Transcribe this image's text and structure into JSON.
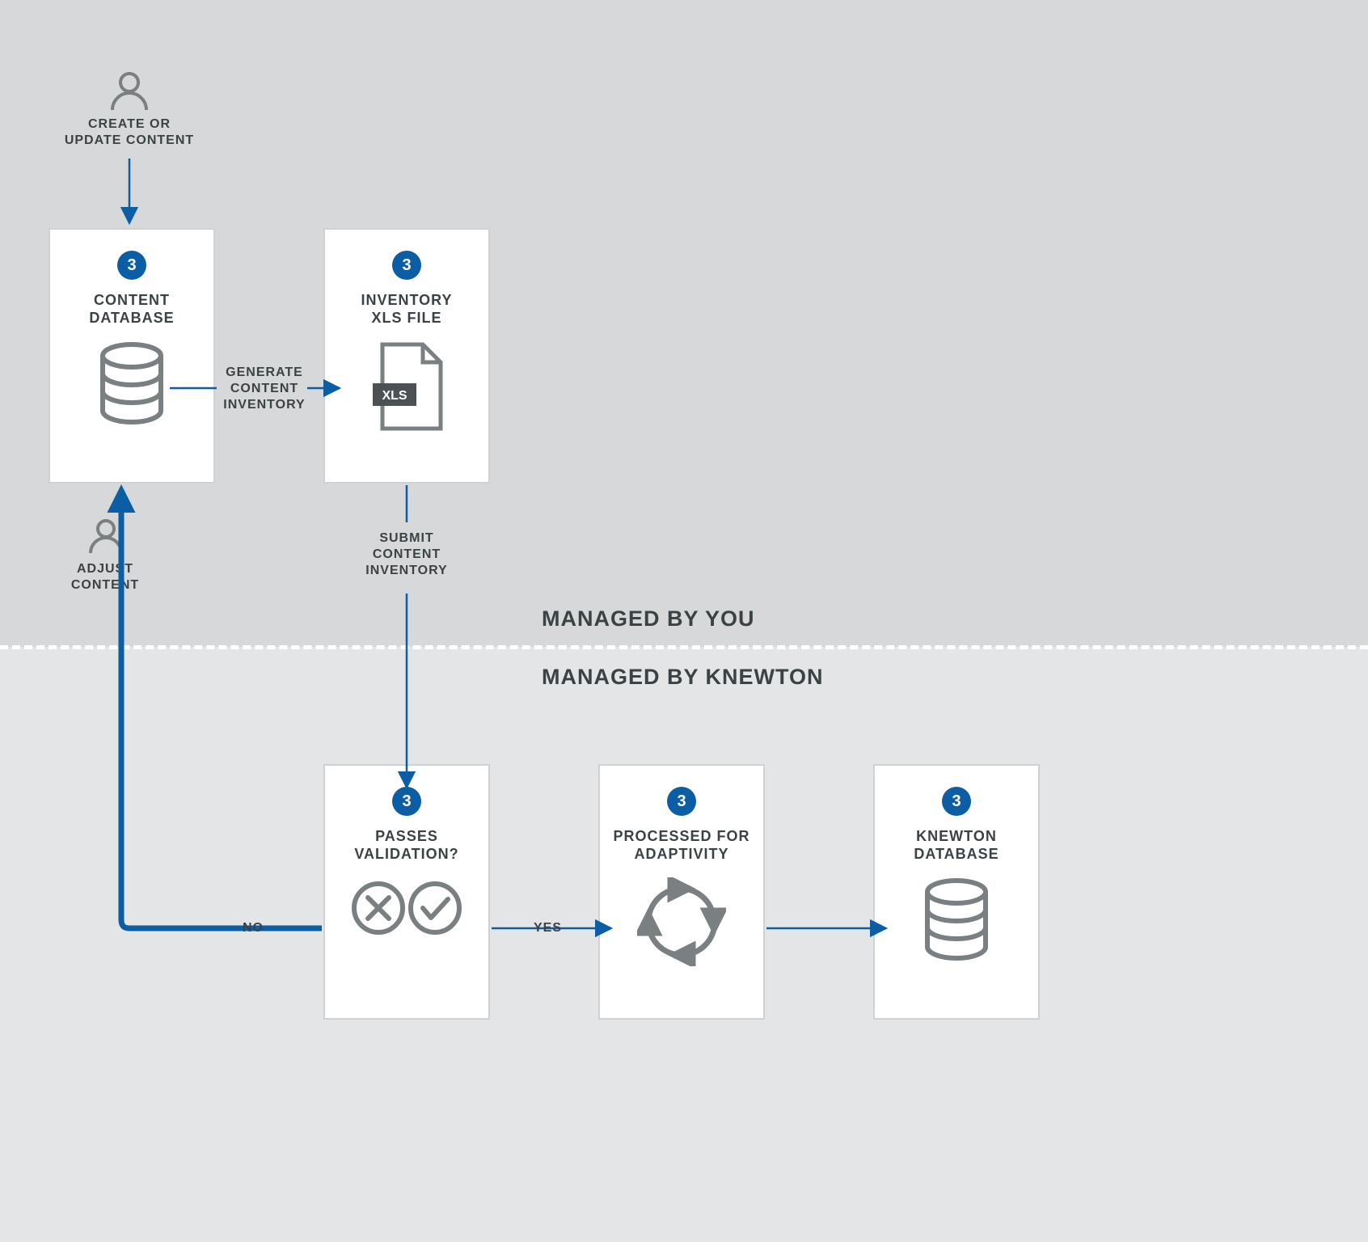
{
  "sections": {
    "top": "MANAGED BY YOU",
    "bottom": "MANAGED BY KNEWTON"
  },
  "actors": {
    "create": "CREATE OR\nUPDATE CONTENT",
    "adjust": "ADJUST\nCONTENT"
  },
  "cards": {
    "content_db": {
      "badge": "3",
      "title": "CONTENT\nDATABASE"
    },
    "inventory": {
      "badge": "3",
      "title": "INVENTORY\nXLS FILE",
      "xls": "XLS"
    },
    "validation": {
      "badge": "3",
      "title": "PASSES\nVALIDATION?"
    },
    "processed": {
      "badge": "3",
      "title": "PROCESSED FOR\nADAPTIVITY"
    },
    "knewton_db": {
      "badge": "3",
      "title": "KNEWTON\nDATABASE"
    }
  },
  "edges": {
    "generate": "GENERATE\nCONTENT\nINVENTORY",
    "submit": "SUBMIT\nCONTENT\nINVENTORY",
    "no": "NO",
    "yes": "YES"
  },
  "colors": {
    "accent": "#0b5ea3",
    "thick": "#0b5ea3"
  }
}
